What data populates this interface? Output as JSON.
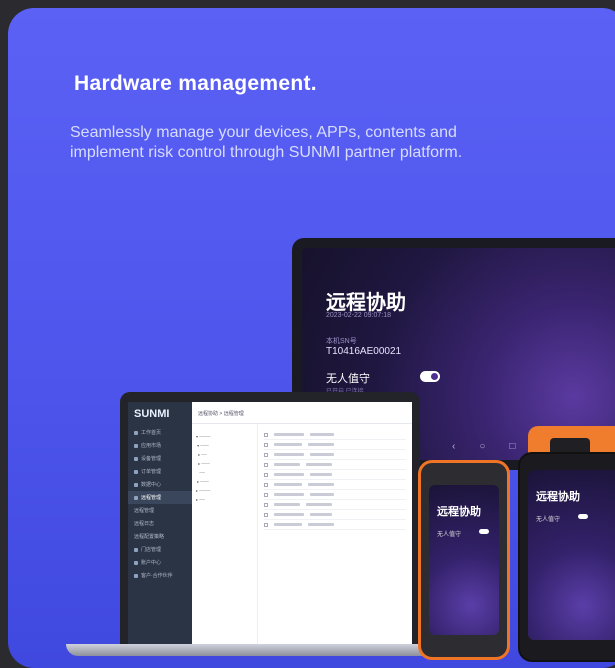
{
  "heading": "Hardware management.",
  "description": "Seamlessly manage your devices, APPs, contents and implement risk control through SUNMI partner platform.",
  "tablet": {
    "title": "远程协助",
    "subtitle": "2023-02-22 09:07:18",
    "sn_label": "本机SN号",
    "sn": "T10416AE00021",
    "option": "无人值守",
    "option_sub": "已开启 已连接"
  },
  "laptop": {
    "logo": "SUNMI",
    "header": "远程协助 > 远程管理",
    "nav": [
      "工作首页",
      "应用市场",
      "设备管理",
      "订单管理",
      "数据中心",
      "远程管理",
      "远程管理",
      "远程日志",
      "远程配置策略",
      "门店管理",
      "账户中心",
      "客户·合作伙伴"
    ]
  },
  "handheld": {
    "title": "远程协助",
    "option": "无人值守"
  }
}
